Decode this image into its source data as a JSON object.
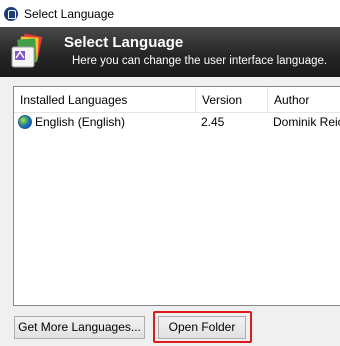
{
  "window": {
    "title": "Select Language",
    "icon": "app-icon"
  },
  "banner": {
    "title": "Select Language",
    "subtitle": "Here you can change the user interface language.",
    "logo_icon": "language-files-icon"
  },
  "list": {
    "columns": [
      "Installed Languages",
      "Version",
      "Author"
    ],
    "rows": [
      {
        "icon": "globe-icon",
        "language": "English (English)",
        "version": "2.45",
        "author": "Dominik Reichl"
      }
    ]
  },
  "buttons": {
    "get_more": "Get More Languages...",
    "open_folder": "Open Folder"
  },
  "colors": {
    "banner_bg": "#262626",
    "highlight": "#e01a1a",
    "list_border": "#828790"
  }
}
